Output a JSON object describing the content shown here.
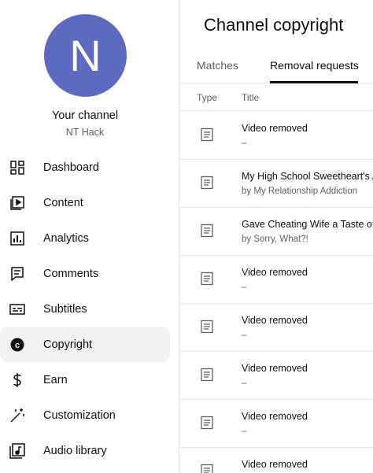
{
  "sidebar": {
    "avatar_letter": "N",
    "avatar_color": "#5c6bc0",
    "channel_label": "Your channel",
    "channel_name": "NT Hack",
    "items": [
      {
        "label": "Dashboard",
        "icon": "dashboard-icon",
        "active": false
      },
      {
        "label": "Content",
        "icon": "content-icon",
        "active": false
      },
      {
        "label": "Analytics",
        "icon": "analytics-icon",
        "active": false
      },
      {
        "label": "Comments",
        "icon": "comments-icon",
        "active": false
      },
      {
        "label": "Subtitles",
        "icon": "subtitles-icon",
        "active": false
      },
      {
        "label": "Copyright",
        "icon": "copyright-icon",
        "active": true
      },
      {
        "label": "Earn",
        "icon": "dollar-icon",
        "active": false
      },
      {
        "label": "Customization",
        "icon": "magic-wand-icon",
        "active": false
      },
      {
        "label": "Audio library",
        "icon": "audio-library-icon",
        "active": false
      }
    ]
  },
  "main": {
    "title": "Channel copyright",
    "tabs": [
      {
        "label": "Matches",
        "active": false
      },
      {
        "label": "Removal requests",
        "active": true
      }
    ],
    "columns": {
      "type": "Type",
      "title": "Title"
    },
    "rows": [
      {
        "title": "Video removed",
        "sub": "–"
      },
      {
        "title": "My High School Sweetheart's A",
        "sub": "by My Relationship Addiction"
      },
      {
        "title": "Gave Cheating Wife a Taste of",
        "sub": "by Sorry, What?!"
      },
      {
        "title": "Video removed",
        "sub": "–"
      },
      {
        "title": "Video removed",
        "sub": "–"
      },
      {
        "title": "Video removed",
        "sub": "–"
      },
      {
        "title": "Video removed",
        "sub": "–"
      },
      {
        "title": "Video removed",
        "sub": "–"
      }
    ]
  }
}
